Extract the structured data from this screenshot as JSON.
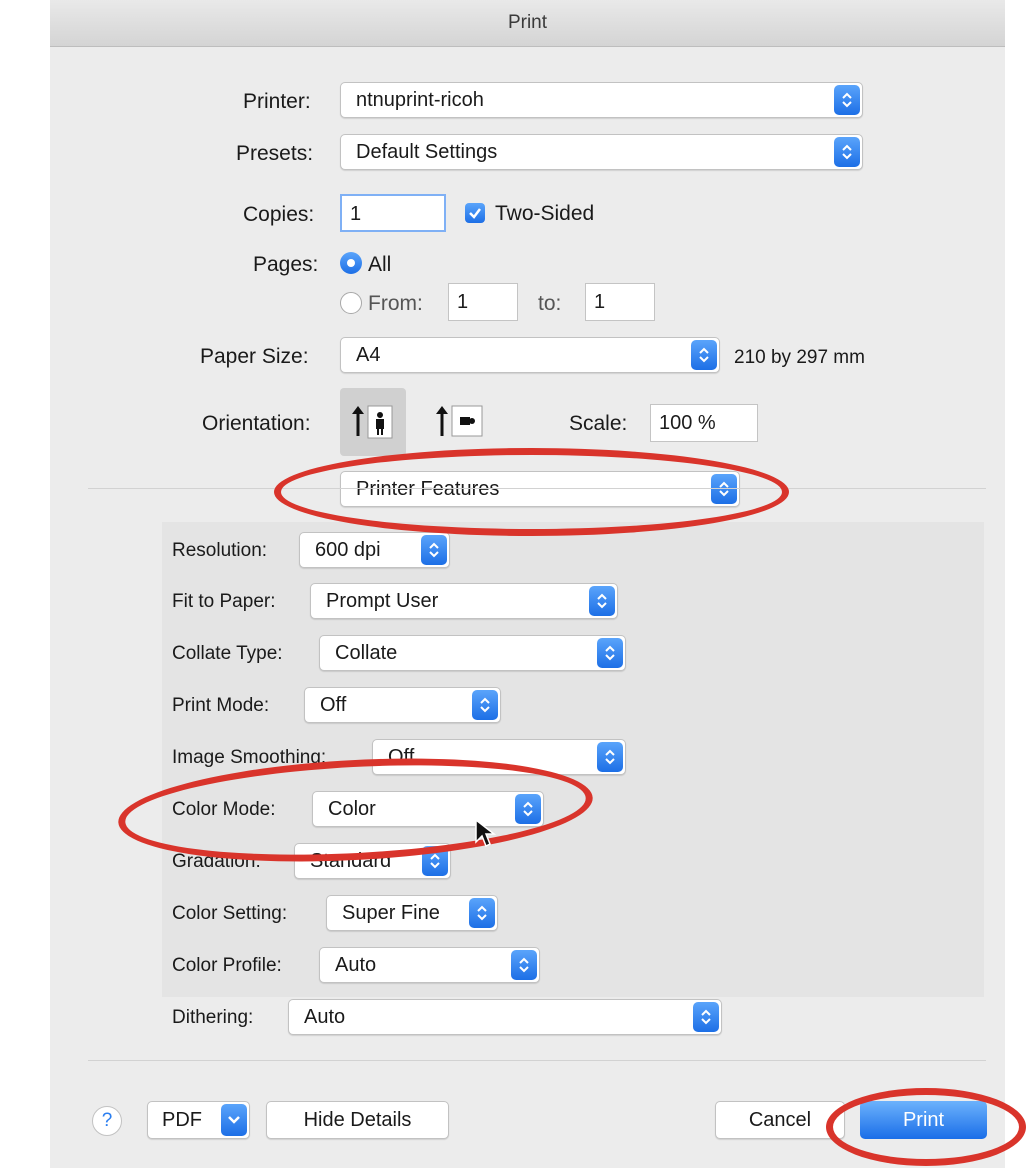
{
  "window": {
    "title": "Print"
  },
  "printer": {
    "label": "Printer:",
    "value": "ntnuprint-ricoh"
  },
  "presets": {
    "label": "Presets:",
    "value": "Default Settings"
  },
  "copies": {
    "label": "Copies:",
    "value": "1",
    "two_sided_label": "Two-Sided",
    "two_sided_checked": true
  },
  "pages": {
    "label": "Pages:",
    "all_label": "All",
    "from_label": "From:",
    "from_value": "1",
    "to_label": "to:",
    "to_value": "1",
    "selected": "All"
  },
  "paper_size": {
    "label": "Paper Size:",
    "value": "A4",
    "dimensions": "210 by 297 mm"
  },
  "orientation": {
    "label": "Orientation:",
    "selected": "portrait"
  },
  "scale": {
    "label": "Scale:",
    "value": "100 %"
  },
  "section_menu": {
    "value": "Printer Features"
  },
  "features": [
    {
      "label": "Resolution:",
      "value": "600 dpi"
    },
    {
      "label": "Fit to Paper:",
      "value": "Prompt User"
    },
    {
      "label": "Collate Type:",
      "value": "Collate"
    },
    {
      "label": "Print Mode:",
      "value": "Off"
    },
    {
      "label": "Image Smoothing:",
      "value": "Off"
    },
    {
      "label": "Color Mode:",
      "value": "Color"
    },
    {
      "label": "Gradation:",
      "value": "Standard"
    },
    {
      "label": "Color Setting:",
      "value": "Super Fine"
    },
    {
      "label": "Color Profile:",
      "value": "Auto"
    },
    {
      "label": "Dithering:",
      "value": "Auto"
    }
  ],
  "footer": {
    "help_label": "?",
    "pdf_label": "PDF",
    "hide_details_label": "Hide Details",
    "cancel_label": "Cancel",
    "print_label": "Print"
  },
  "colors": {
    "accent": "#1d6fe6",
    "annotation": "#d9342b",
    "dialog_bg": "#ececec"
  }
}
